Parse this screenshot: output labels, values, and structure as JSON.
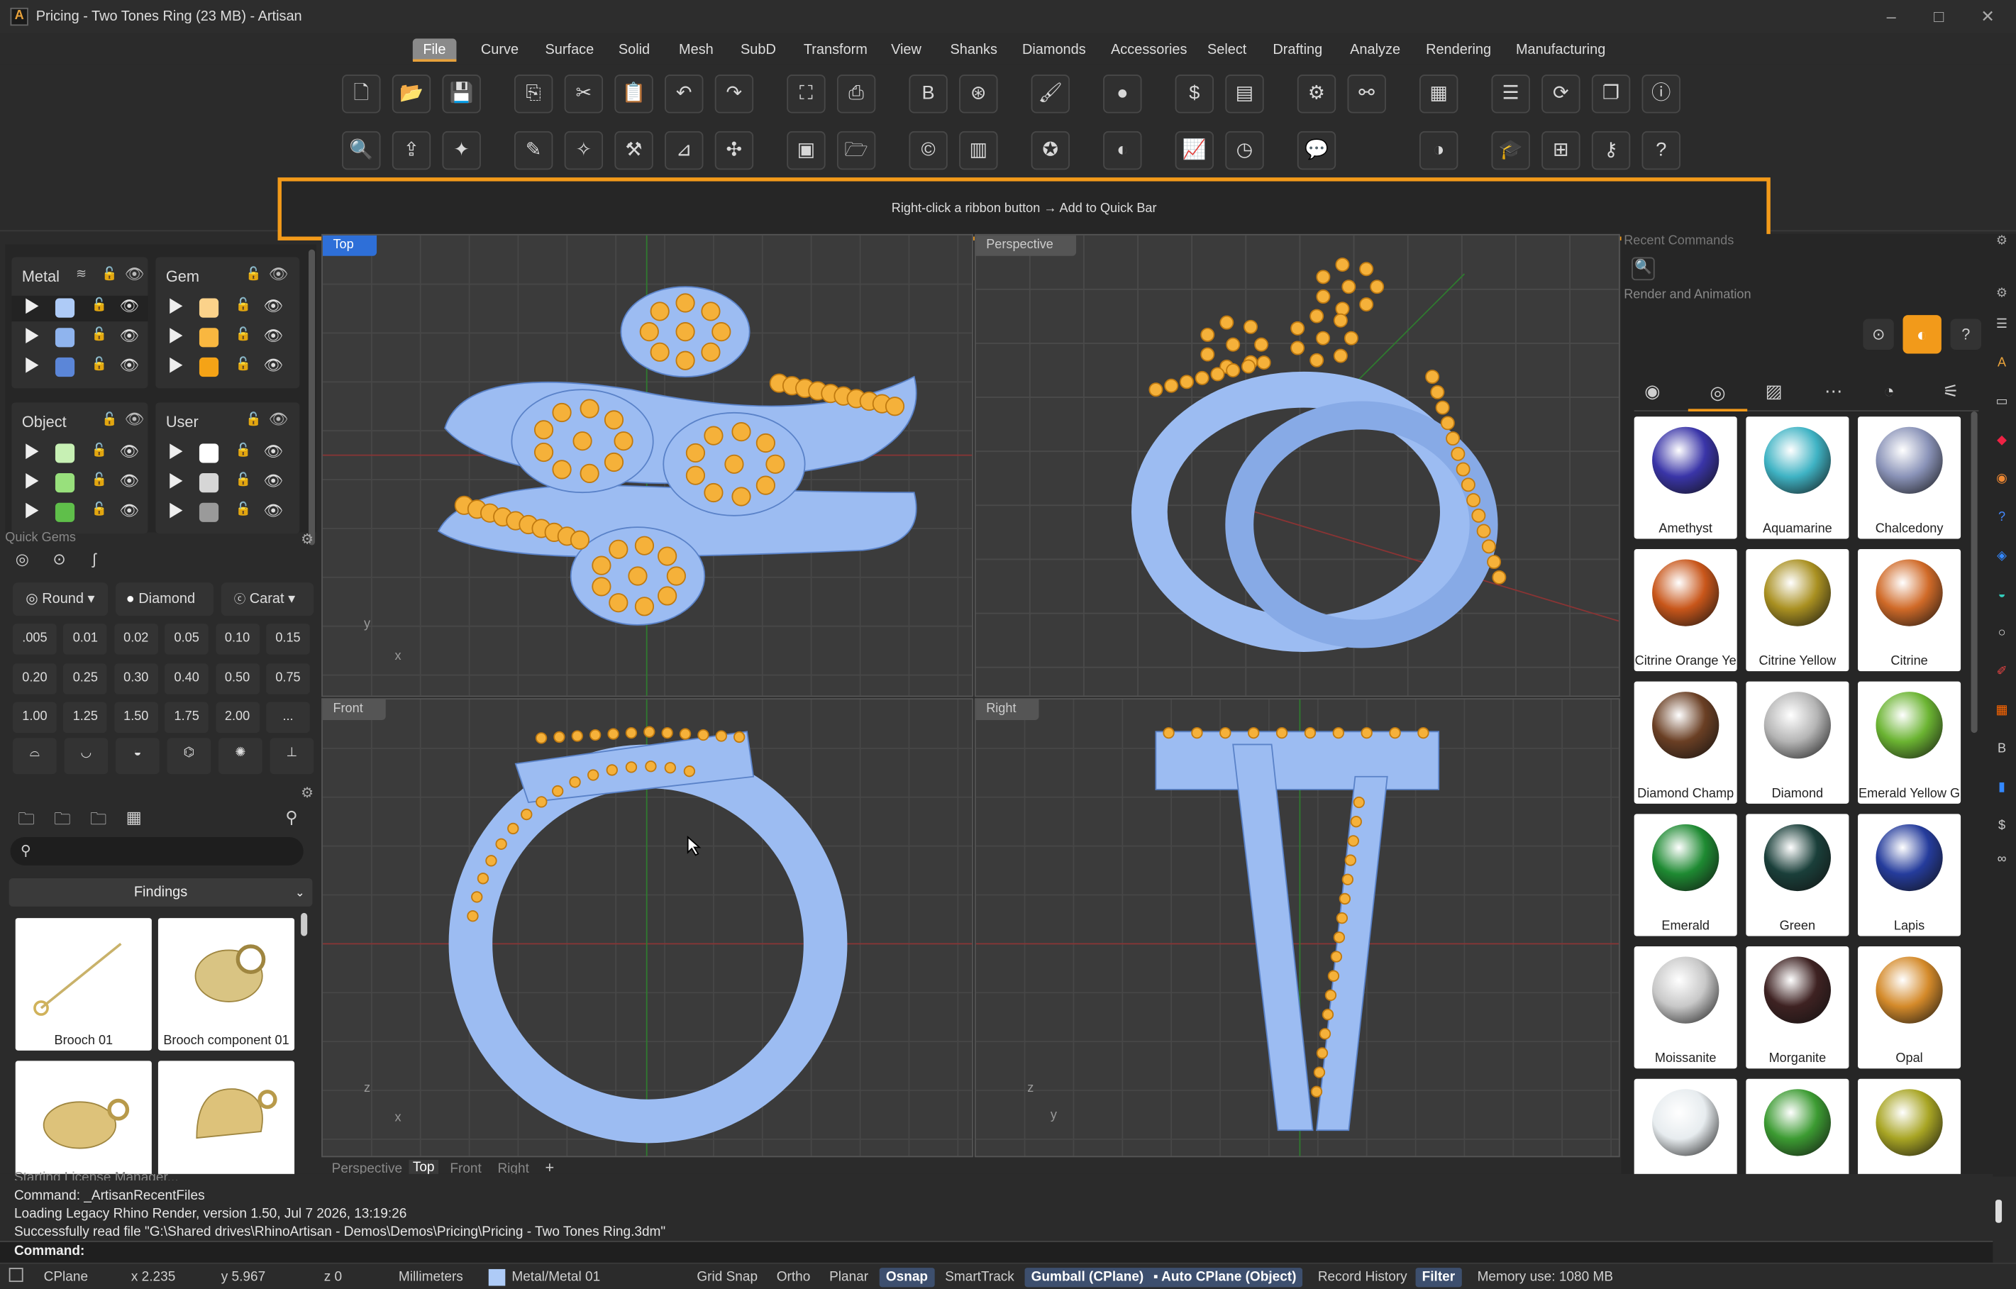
{
  "window": {
    "title": "Pricing - Two Tones Ring (23 MB) - Artisan",
    "logo": "A",
    "min": "–",
    "max": "□",
    "close": "✕"
  },
  "menu": {
    "items": [
      "File",
      "Curve",
      "Surface",
      "Solid",
      "Mesh",
      "SubD",
      "Transform",
      "View",
      "Shanks",
      "Diamonds",
      "Accessories",
      "Select",
      "Drafting",
      "Analyze",
      "Rendering",
      "Manufacturing"
    ],
    "active": "File"
  },
  "quickbar": {
    "text": "Right-click a ribbon button → Add to Quick Bar"
  },
  "layers": {
    "groups": [
      {
        "title": "Metal",
        "colors": [
          "#aecbf7",
          "#8fb4ee",
          "#5b86d8"
        ]
      },
      {
        "title": "Gem",
        "colors": [
          "#fbd28a",
          "#f9b740",
          "#f5a316"
        ]
      },
      {
        "title": "Object",
        "colors": [
          "#c7f0b4",
          "#98e07c",
          "#5fbf4a"
        ]
      },
      {
        "title": "User",
        "colors": [
          "#ffffff",
          "#d6d6d6",
          "#9a9a9a"
        ]
      }
    ]
  },
  "quick_gems": {
    "title": "Quick Gems",
    "shape": "Round",
    "material": "Diamond",
    "unit": "Carat",
    "sizes": [
      ".005",
      "0.01",
      "0.02",
      "0.05",
      "0.10",
      "0.15",
      "0.20",
      "0.25",
      "0.30",
      "0.40",
      "0.50",
      "0.75",
      "1.00",
      "1.25",
      "1.50",
      "1.75",
      "2.00",
      "..."
    ]
  },
  "library": {
    "category": "Findings",
    "search_placeholder": "",
    "items": [
      {
        "label": "Brooch 01"
      },
      {
        "label": "Brooch component 01"
      },
      {
        "label": ""
      },
      {
        "label": ""
      }
    ]
  },
  "viewports": {
    "top": "Top",
    "perspective": "Perspective",
    "front": "Front",
    "right": "Right"
  },
  "view_tabs": [
    "Perspective",
    "Top",
    "Front",
    "Right"
  ],
  "view_tabs_active": "Top",
  "view_tabs_add": "+",
  "right_panel": {
    "recent_title": "Recent Commands",
    "render_title": "Render and Animation",
    "help": "?",
    "gems": [
      {
        "label": "Amethyst",
        "color": "#3a35a8"
      },
      {
        "label": "Aquamarine",
        "color": "#3fb3c4"
      },
      {
        "label": "Chalcedony",
        "color": "#8a93b8"
      },
      {
        "label": "Citrine Orange Ye",
        "color": "#c8561a"
      },
      {
        "label": "Citrine Yellow",
        "color": "#a99021"
      },
      {
        "label": "Citrine",
        "color": "#d06a28"
      },
      {
        "label": "Diamond Champ",
        "color": "#6a3f24"
      },
      {
        "label": "Diamond",
        "color": "#b5b5b5"
      },
      {
        "label": "Emerald Yellow G",
        "color": "#6bb432"
      },
      {
        "label": "Emerald",
        "color": "#1e8a32"
      },
      {
        "label": "Green",
        "color": "#1a3f3a"
      },
      {
        "label": "Lapis",
        "color": "#253c9c"
      },
      {
        "label": "Moissanite",
        "color": "#c8c8c8"
      },
      {
        "label": "Morganite",
        "color": "#3e2222"
      },
      {
        "label": "Opal",
        "color": "#d48a2a"
      },
      {
        "label": "",
        "color": "#e7ecef"
      },
      {
        "label": "",
        "color": "#3c9b32"
      },
      {
        "label": "",
        "color": "#a8a524"
      }
    ]
  },
  "command_history": [
    "Starting License Manager...",
    "Command: _ArtisanRecentFiles",
    "Loading Legacy Rhino Render, version 1.50, Jul  7 2026, 13:19:26",
    "Successfully read file \"G:\\Shared drives\\RhinoArtisan - Demos\\Demos\\Pricing\\Pricing - Two Tones Ring.3dm\""
  ],
  "command_prompt": "Command:",
  "status": {
    "cplane": "CPlane",
    "x": "x 2.235",
    "y": "y 5.967",
    "z": "z 0",
    "units": "Millimeters",
    "layer": "Metal/Metal 01",
    "layer_color": "#aecbf7",
    "grid_snap": "Grid Snap",
    "ortho": "Ortho",
    "planar": "Planar",
    "osnap": "Osnap",
    "smarttrack": "SmartTrack",
    "gumball": "Gumball (CPlane)",
    "auto_cplane": "Auto CPlane (Object)",
    "record_history": "Record History",
    "filter": "Filter",
    "memory": "Memory use: 1080 MB"
  },
  "colors": {
    "accent": "#f29a1a",
    "metal": "#9cbcf2",
    "gem": "#f5b13a",
    "active_tab": "#2e6fd8"
  }
}
